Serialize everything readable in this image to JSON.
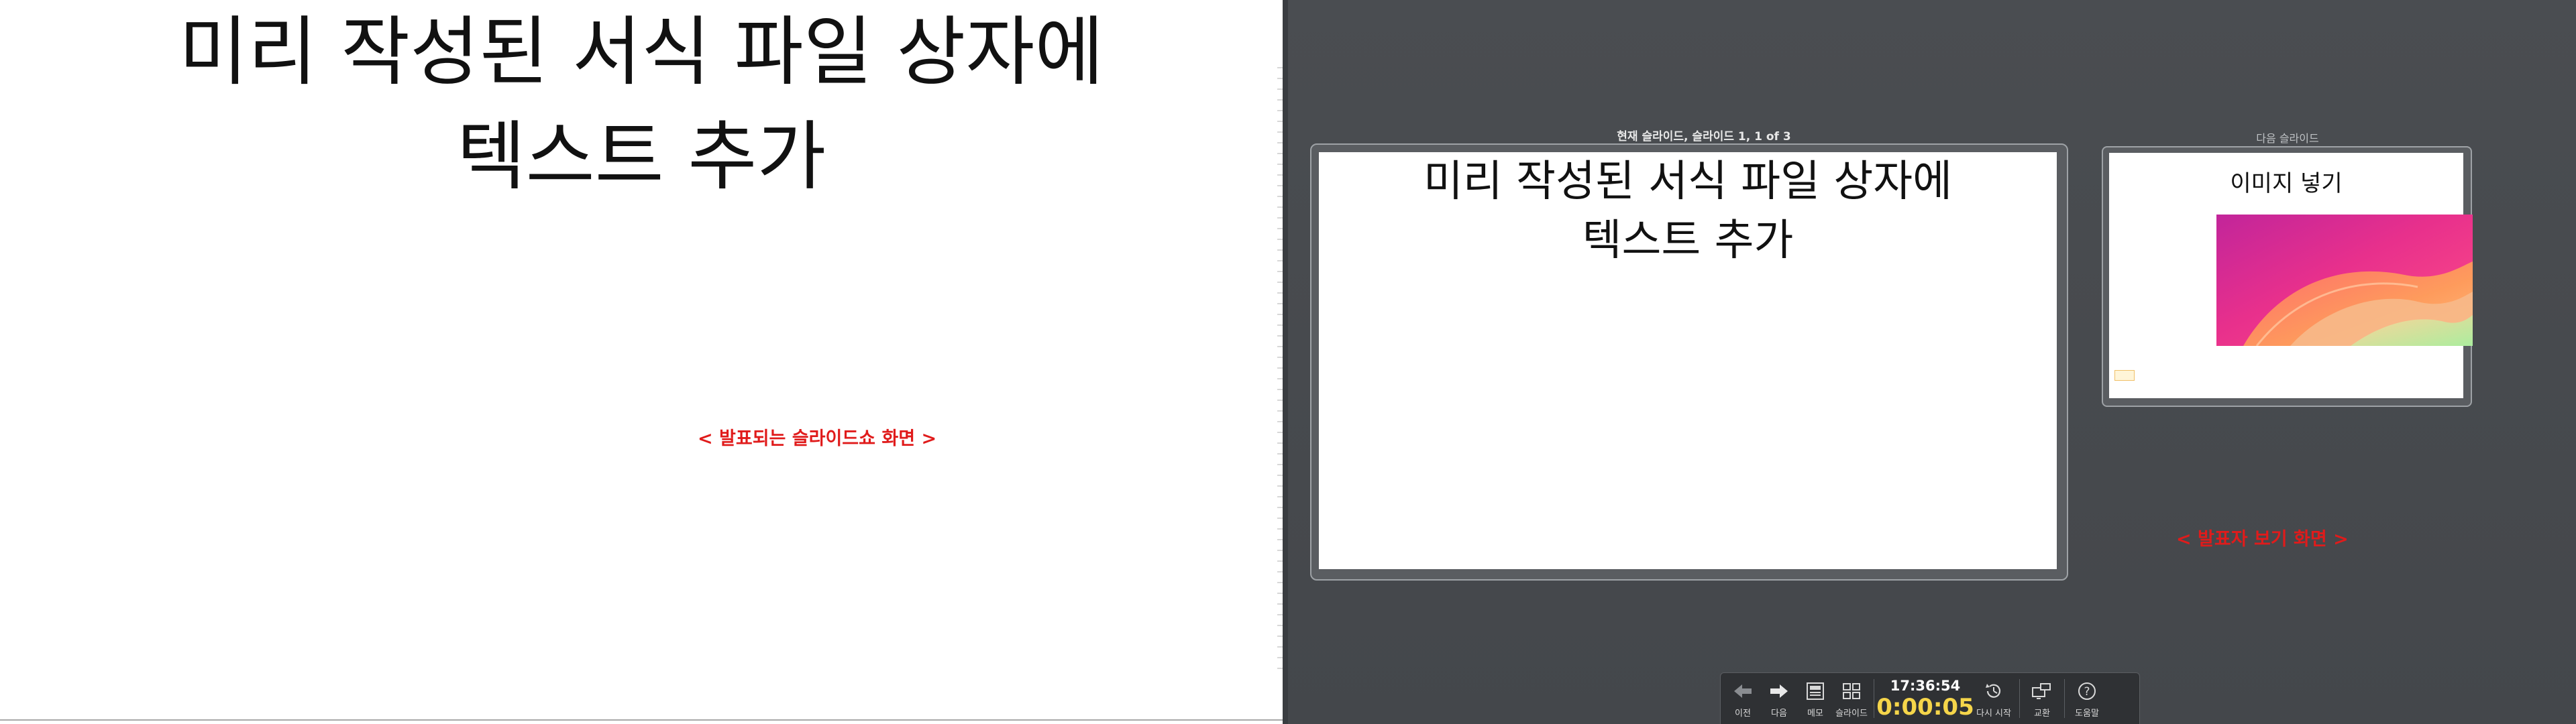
{
  "slideshow": {
    "title_line1": "미리 작성된 서식 파일 상자에",
    "title_line2": "텍스트 추가",
    "annotation": "< 발표되는 슬라이드쇼 화면 >"
  },
  "presenter": {
    "current_label": "현재 슬라이드, 슬라이드 1, 1 of 3",
    "current_slide": {
      "title_line1": "미리 작성된 서식 파일 상자에",
      "title_line2": "텍스트 추가"
    },
    "next_label": "다음 슬라이드",
    "next_slide": {
      "title": "이미지 넣기"
    },
    "annotation": "< 발표자 보기 화면 >",
    "toolbar": {
      "prev_label": "이전",
      "next_label": "다음",
      "notes_label": "메모",
      "slides_label": "슬라이드",
      "clock": "17:36:54",
      "elapsed": "0:00:05",
      "restart_label": "다시 시작",
      "swap_label": "교환",
      "help_label": "도움말"
    }
  },
  "colors": {
    "annotation": "#e01b1b",
    "elapsed": "#f5d54a",
    "presenter_bg": "#47494d"
  },
  "icons": {
    "prev": "arrow-left-icon",
    "next": "arrow-right-icon",
    "notes": "notes-icon",
    "slides": "grid-icon",
    "restart": "clock-restart-icon",
    "swap": "swap-monitor-icon",
    "help": "help-icon"
  }
}
